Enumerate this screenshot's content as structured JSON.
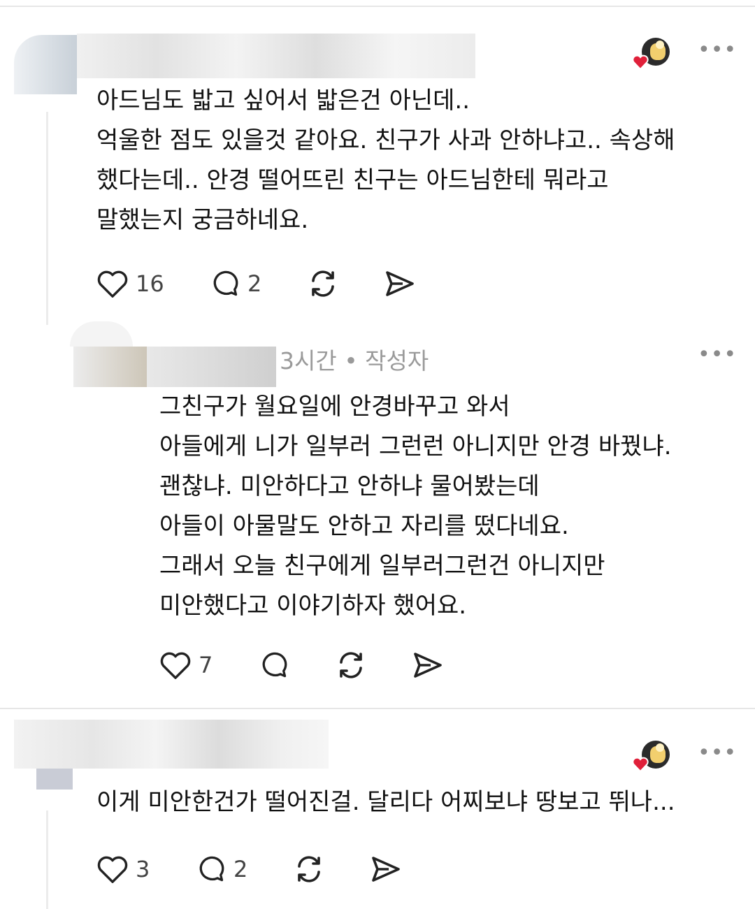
{
  "comments": [
    {
      "text": "아드님도 밟고 싶어서 밟은건 아닌데..\n억울한 점도 있을것 같아요. 친구가 사과 안하냐고.. 속상해\n했다는데.. 안경 떨어뜨린 친구는 아드님한테 뭐라고\n말했는지 궁금하네요.",
      "lines": [
        "아드님도 밟고 싶어서 밟은건 아닌데..",
        "억울한 점도 있을것 같아요. 친구가 사과 안하냐고.. 속상해",
        "했다는데.. 안경 떨어뜨린 친구는 아드님한테 뭐라고",
        "말했는지 궁금하네요."
      ],
      "likes": "16",
      "replies": "2"
    },
    {
      "meta": "3시간 • 작성자",
      "lines": [
        "그친구가 월요일에 안경바꾸고 와서",
        "아들에게 니가 일부러 그런런 아니지만 안경 바꿨냐.",
        "괜찮냐. 미안하다고 안하냐 물어봤는데",
        "아들이 아물말도 안하고 자리를 떴다네요.",
        "그래서 오늘 친구에게 일부러그런건 아니지만",
        "미안했다고 이야기하자 했어요."
      ],
      "likes": "7"
    },
    {
      "lines": [
        "이게 미안한건가 떨어진걸. 달리다 어찌보냐 땅보고 뛰나..."
      ],
      "likes": "3",
      "replies": "2"
    }
  ],
  "icons": {
    "like": "heart-icon",
    "reply": "comment-bubble-icon",
    "repost": "repost-icon",
    "share": "send-icon",
    "more": "more-dots-icon"
  },
  "colors": {
    "text": "#111111",
    "muted": "#9a9a9a",
    "divider": "#e6e6e6",
    "heart_badge": "#e0203a"
  }
}
